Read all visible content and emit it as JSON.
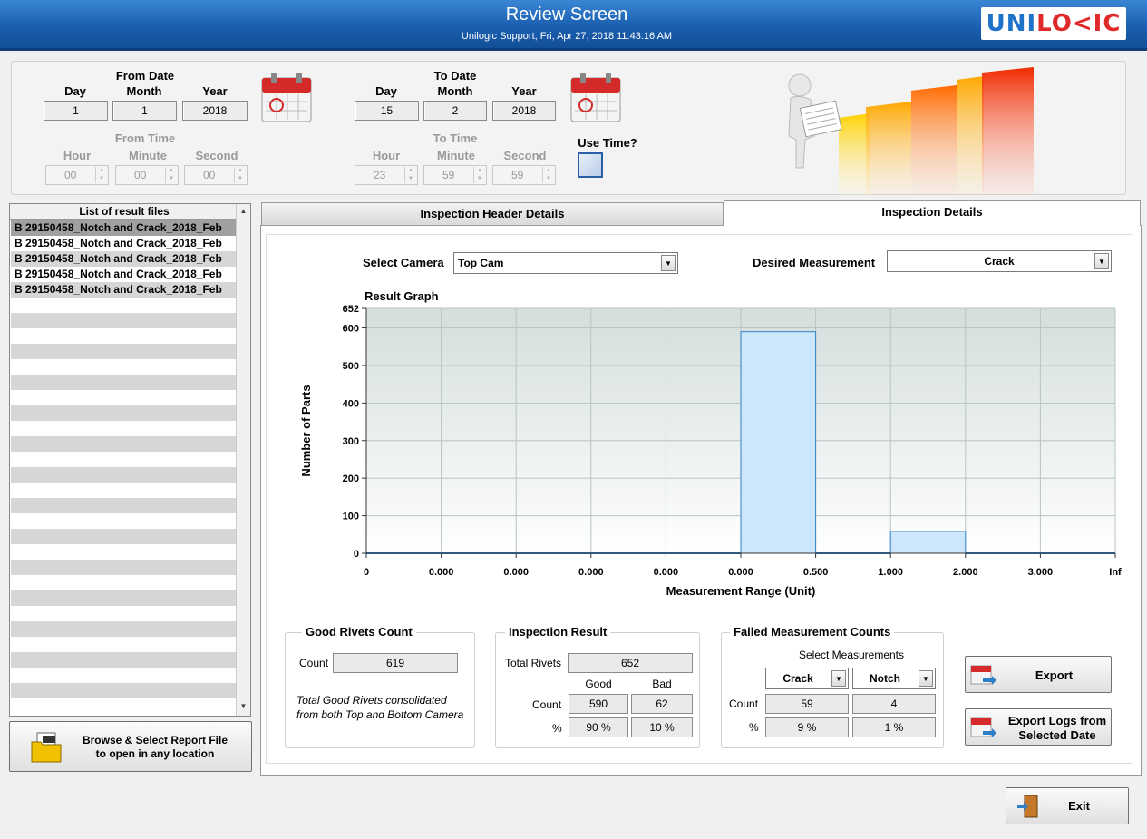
{
  "window": {
    "title": "Review Screen",
    "subtitle": "Unilogic Support, Fri, Apr 27, 2018 11:43:16 AM",
    "logo": {
      "part1": "UNI",
      "part2": "LO<IC"
    }
  },
  "from_date": {
    "group_label": "From Date",
    "day_label": "Day",
    "month_label": "Month",
    "year_label": "Year",
    "day": "1",
    "month": "1",
    "year": "2018",
    "time_group_label": "From Time",
    "hour_label": "Hour",
    "minute_label": "Minute",
    "second_label": "Second",
    "hour": "00",
    "minute": "00",
    "second": "00"
  },
  "to_date": {
    "group_label": "To Date",
    "day_label": "Day",
    "month_label": "Month",
    "year_label": "Year",
    "day": "15",
    "month": "2",
    "year": "2018",
    "time_group_label": "To Time",
    "hour_label": "Hour",
    "minute_label": "Minute",
    "second_label": "Second",
    "hour": "23",
    "minute": "59",
    "second": "59"
  },
  "use_time_label": "Use Time?",
  "file_list": {
    "header": "List of result files",
    "items": [
      "B 29150458_Notch and Crack_2018_Feb",
      "B 29150458_Notch and Crack_2018_Feb",
      "B 29150458_Notch and Crack_2018_Feb",
      "B 29150458_Notch and Crack_2018_Feb",
      "B 29150458_Notch and Crack_2018_Feb"
    ]
  },
  "browse_button": {
    "line1": "Browse & Select Report File",
    "line2": "to open in any location"
  },
  "tabs": {
    "header_details": "Inspection  Header Details",
    "inspection_details": "Inspection Details"
  },
  "controls": {
    "select_camera_label": "Select Camera",
    "camera": "Top Cam",
    "desired_measurement_label": "Desired Measurement",
    "measurement": "Crack"
  },
  "chart_data": {
    "type": "bar",
    "title": "Result Graph",
    "xlabel": "Measurement Range (Unit)",
    "ylabel": "Number of Parts",
    "categories": [
      "0-0.000",
      "0.000-0.000",
      "0.000-0.000",
      "0.000-0.000",
      "0.000-0.000",
      "0.000-0.500",
      "0.500-1.000",
      "1.000-2.000",
      "2.000-3.000",
      "3.000-Inf"
    ],
    "x_tick_labels": [
      "0",
      "0.000",
      "0.000",
      "0.000",
      "0.000",
      "0.000",
      "0.500",
      "1.000",
      "2.000",
      "3.000",
      "Inf"
    ],
    "values": [
      0,
      0,
      0,
      0,
      0,
      590,
      0,
      58,
      0,
      0
    ],
    "y_ticks": [
      0,
      100,
      200,
      300,
      400,
      500,
      600,
      652
    ],
    "ylim": [
      0,
      652
    ],
    "grid": true,
    "bar_color": "#cce6fb",
    "bar_edge_color": "#2f7fc8"
  },
  "good_rivets": {
    "title": "Good Rivets Count",
    "count_label": "Count",
    "count": "619",
    "note": "Total Good Rivets consolidated from both Top and Bottom Camera"
  },
  "inspection_result": {
    "title": "Inspection Result",
    "total_label": "Total Rivets",
    "total": "652",
    "good_label": "Good",
    "bad_label": "Bad",
    "count_label": "Count",
    "good_count": "590",
    "bad_count": "62",
    "pct_label": "%",
    "good_pct": "90 %",
    "bad_pct": "10 %"
  },
  "failed_counts": {
    "title": "Failed Measurement Counts",
    "select_label": "Select Measurements",
    "m1": "Crack",
    "m2": "Notch",
    "count_label": "Count",
    "m1_count": "59",
    "m2_count": "4",
    "pct_label": "%",
    "m1_pct": "9 %",
    "m2_pct": "1 %"
  },
  "buttons": {
    "export": "Export",
    "export_logs_line1": "Export Logs from",
    "export_logs_line2": "Selected Date",
    "exit": "Exit"
  },
  "colors": {
    "titlebar": "#1a5fb0",
    "accent_red": "#e02a2a",
    "accent_blue": "#1e73c8"
  }
}
